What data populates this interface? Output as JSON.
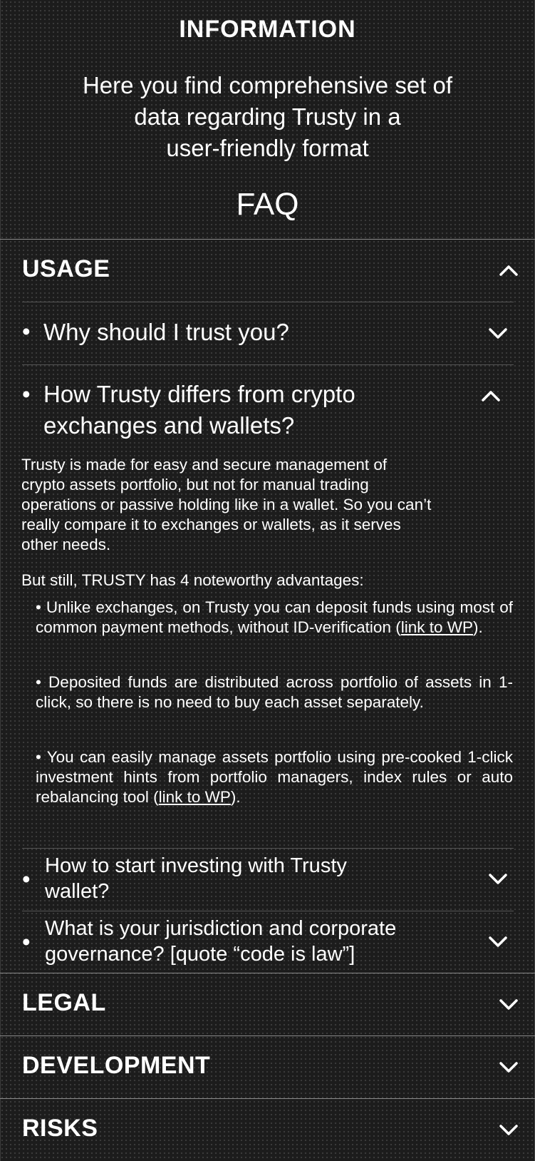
{
  "header": {
    "title": "INFORMATION",
    "subtitle_lines": [
      "Here you find comprehensive set of",
      "data regarding Trusty in a",
      "user-friendly format"
    ],
    "faq_title": "FAQ"
  },
  "sections": {
    "usage": {
      "label": "USAGE",
      "questions": [
        {
          "bullet": "•",
          "text": "Why should I trust you?"
        },
        {
          "bullet": "•",
          "line1": "How Trusty differs from crypto",
          "line2": "exchanges and wallets?"
        },
        {
          "bullet": "•",
          "line1": "How to start investing with Trusty",
          "line2": "wallet?"
        },
        {
          "bullet": "•",
          "line1": "What is your jurisdiction and corporate",
          "line2": "governance? [quote “code is law”]"
        }
      ],
      "answer": {
        "paragraph1_lines": [
          "Trusty is made for easy and secure management of",
          "crypto assets portfolio, but not for manual trading",
          "operations or passive holding like in a wallet. So you can’t",
          "really compare it to exchanges or wallets, as it serves",
          "other needs."
        ],
        "paragraph2": "But still, TRUSTY has 4 noteworthy advantages:",
        "adv1_text": "• Unlike exchanges, on Trusty you can deposit funds using most of common payment methods, without ID-verification (",
        "adv1_link": "link to WP",
        "adv1_end": ").",
        "adv2_text": "• Deposited funds are distributed across portfolio of assets in 1-click, so there is no need to buy each asset separately.",
        "adv3_text": "• You can easily manage assets portfolio using pre-cooked 1-click investment hints from portfolio managers, index rules or auto rebalancing tool (",
        "adv3_link": "link to WP",
        "adv3_end": ")."
      }
    },
    "legal": {
      "label": "LEGAL"
    },
    "development": {
      "label": "DEVELOPMENT"
    },
    "risks": {
      "label": "RISKS"
    }
  },
  "icons": {
    "expand": "chevron-down-icon",
    "collapse": "chevron-up-icon"
  },
  "colors": {
    "background": "#1c1c1c",
    "text": "#ffffff",
    "divider": "#8a8a8a"
  }
}
